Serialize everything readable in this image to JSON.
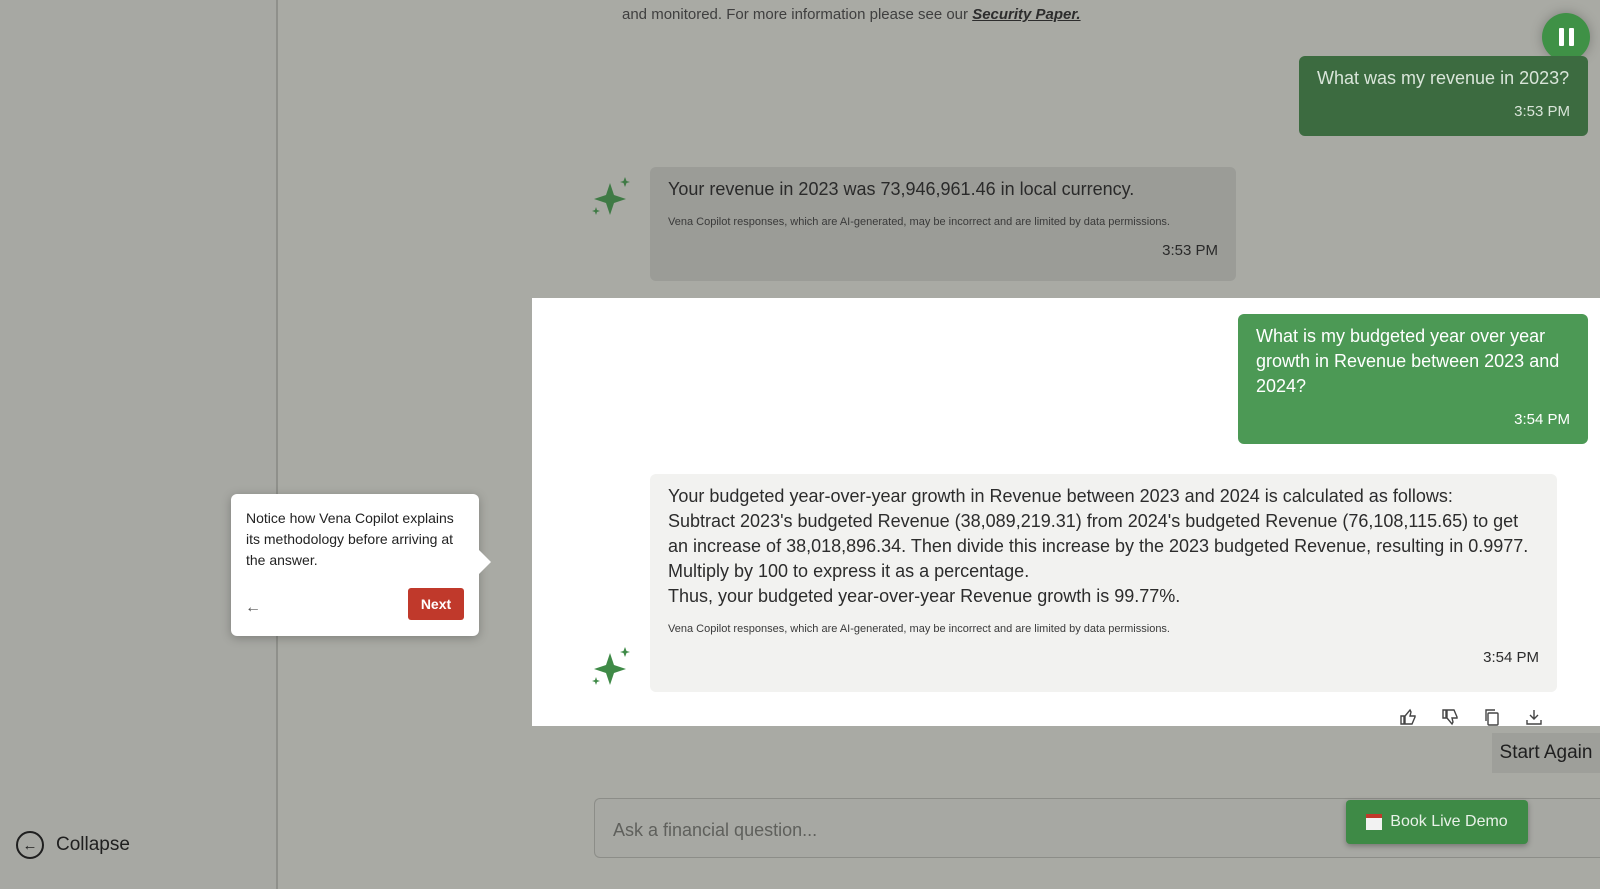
{
  "sidebar": {
    "collapse_label": "Collapse",
    "collapse_icon": "circle-arrow-left-icon"
  },
  "security_notice": {
    "text": "and monitored. For more information please see our",
    "link": "Security Paper."
  },
  "conversation": {
    "messages": [
      {
        "role": "user",
        "text": "What was my revenue in 2023?",
        "time": "3:53 PM"
      },
      {
        "role": "assistant",
        "text": "Your revenue in 2023 was 73,946,961.46 in local currency.",
        "disclaimer": "Vena Copilot responses, which are AI-generated, may be incorrect and are limited by data permissions.",
        "time": "3:53 PM"
      },
      {
        "role": "user",
        "text": "What is my budgeted year over year growth in Revenue between 2023 and 2024?",
        "time": "3:54 PM"
      },
      {
        "role": "assistant",
        "lines": [
          "Your budgeted year-over-year growth in Revenue between 2023 and 2024 is calculated as follows:",
          "Subtract 2023's budgeted Revenue (38,089,219.31) from 2024's budgeted Revenue (76,108,115.65) to get an increase of 38,018,896.34. Then divide this increase by the 2023 budgeted Revenue, resulting in 0.9977.",
          "Multiply by 100 to express it as a percentage.",
          "Thus, your budgeted year-over-year Revenue growth is 99.77%."
        ],
        "disclaimer": "Vena Copilot responses, which are AI-generated, may be incorrect and are limited by data permissions.",
        "time": "3:54 PM"
      }
    ]
  },
  "message_actions": [
    "thumbs-up-icon",
    "thumbs-down-icon",
    "copy-icon",
    "download-icon"
  ],
  "start_again_label": "Start Again",
  "input": {
    "placeholder": "Ask a financial question..."
  },
  "book_demo_label": "Book Live Demo",
  "tooltip": {
    "text": "Notice how Vena Copilot explains its methodology before arriving at the answer.",
    "next_label": "Next"
  },
  "colors": {
    "user_bubble": "#4c9955",
    "accent_red": "#c0392b",
    "overlay": "#a9aaa4"
  }
}
